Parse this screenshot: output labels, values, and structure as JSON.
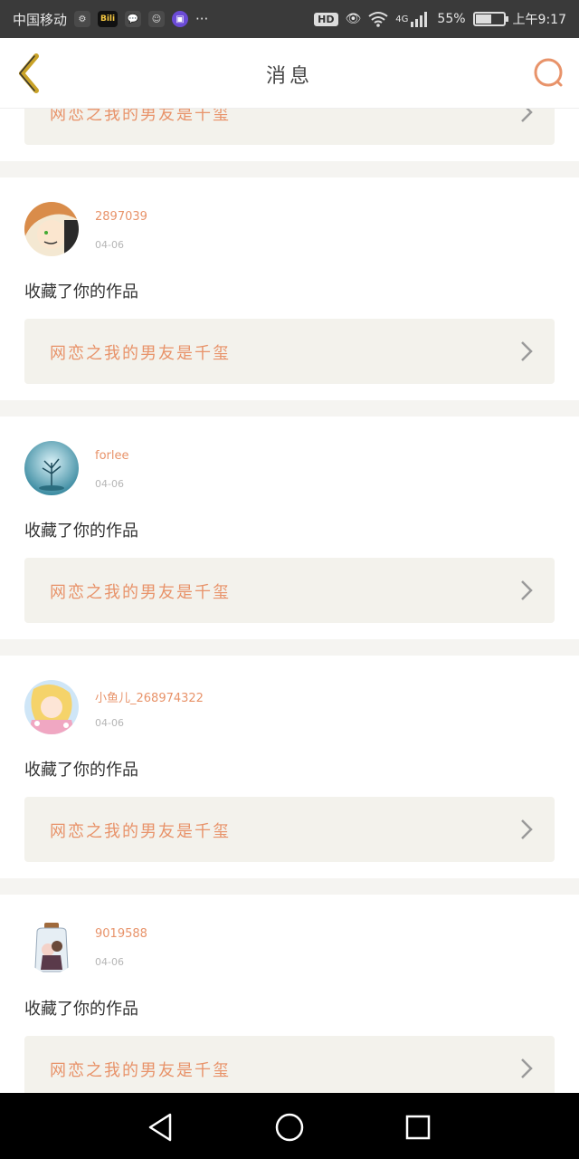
{
  "status_bar": {
    "carrier": "中国移动",
    "network": "4G",
    "battery_percent": "55%",
    "time": "上午9:17",
    "battery_level": 0.55,
    "icons": [
      "settings-icon",
      "bilibili-icon",
      "wechat-icon",
      "qq-icon",
      "app-icon",
      "more-icon",
      "hd-icon",
      "eye-icon",
      "wifi-icon",
      "signal-icon",
      "battery-icon"
    ],
    "bili_label": "Bili",
    "hd_label": "HD",
    "more": "···"
  },
  "header": {
    "title": "消息",
    "back_icon": "chevron-left-icon",
    "search_icon": "search-icon",
    "accent_color": "#e8936a",
    "back_color": "#c9a227"
  },
  "partial_card": {
    "title": "网恋之我的男友是千玺"
  },
  "messages": [
    {
      "user": "2897039",
      "date": "04-06",
      "action": "收藏了你的作品",
      "work_title": "网恋之我的男友是千玺"
    },
    {
      "user": "forlee",
      "date": "04-06",
      "action": "收藏了你的作品",
      "work_title": "网恋之我的男友是千玺"
    },
    {
      "user": "小鱼儿_268974322",
      "date": "04-06",
      "action": "收藏了你的作品",
      "work_title": "网恋之我的男友是千玺"
    },
    {
      "user": "9019588",
      "date": "04-06",
      "action": "收藏了你的作品",
      "work_title": "网恋之我的男友是千玺"
    }
  ],
  "nav": {
    "back": "nav-back-icon",
    "home": "nav-home-icon",
    "recents": "nav-recents-icon"
  }
}
